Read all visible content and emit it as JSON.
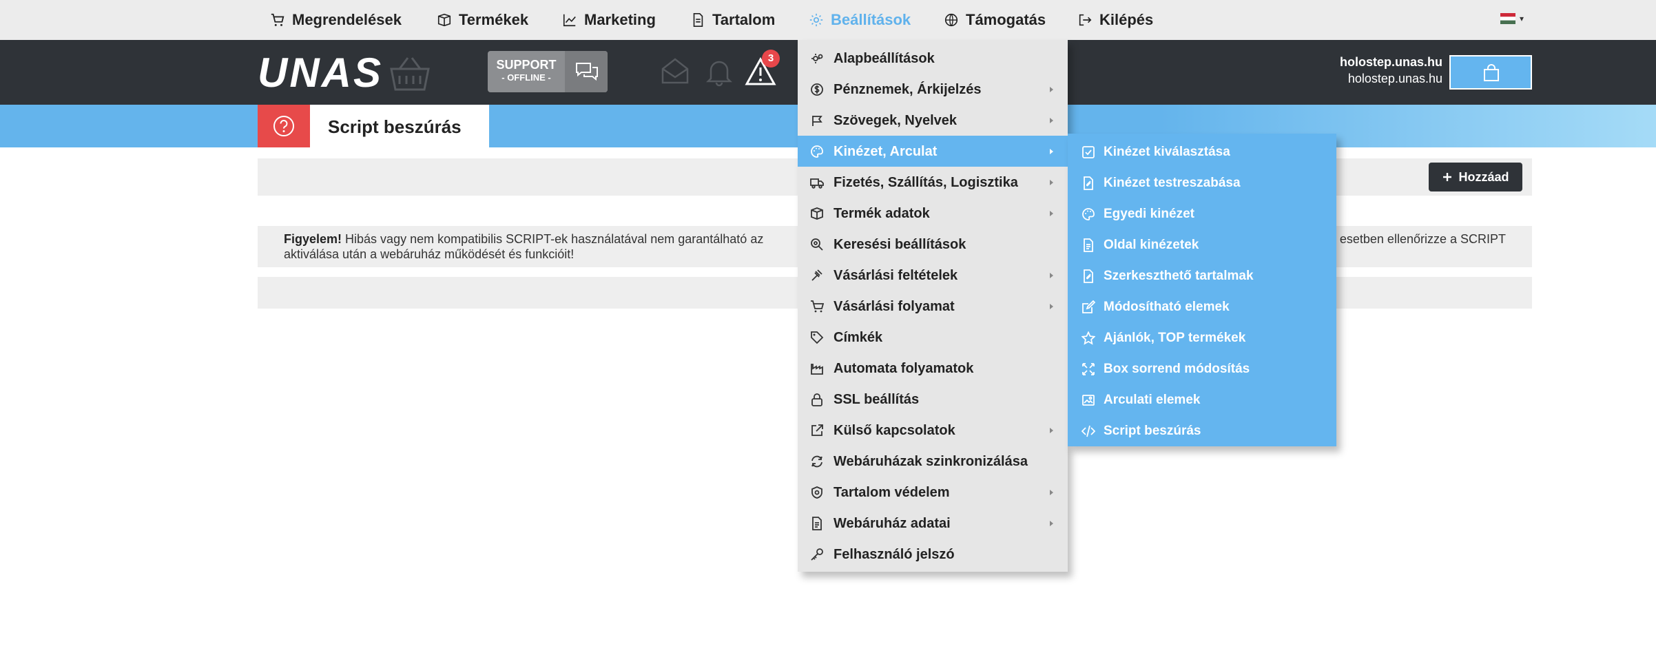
{
  "topnav": {
    "items": [
      {
        "label": "Megrendelések",
        "icon": "cart-icon"
      },
      {
        "label": "Termékek",
        "icon": "box-icon"
      },
      {
        "label": "Marketing",
        "icon": "chart-icon"
      },
      {
        "label": "Tartalom",
        "icon": "document-icon"
      },
      {
        "label": "Beállítások",
        "icon": "gear-icon",
        "active": true
      },
      {
        "label": "Támogatás",
        "icon": "globe-icon"
      },
      {
        "label": "Kilépés",
        "icon": "logout-icon"
      }
    ],
    "language_flag": "hungarian-flag-icon",
    "active_color": "#60b2ec"
  },
  "header": {
    "logo_text": "UNAS",
    "support_title": "SUPPORT",
    "support_status": "- OFFLINE -",
    "alert_count": "3",
    "domain_primary": "holostep.unas.hu",
    "domain_secondary": "holostep.unas.hu",
    "accent_color": "#64b5ef",
    "bar_color": "#2f3338"
  },
  "page": {
    "title": "Script beszúrás",
    "add_button_label": "Hozzáad",
    "notice_strong": "Figyelem!",
    "notice_text_1": " Hibás vagy nem kompatibilis SCRIPT-ek használatával nem garantálható az ",
    "notice_text_2": "esetben ellenőrizze a SCRIPT",
    "notice_text_3": "aktiválása után a webáruház működését és funkcióit!"
  },
  "settings_menu": {
    "items": [
      {
        "label": "Alapbeállítások",
        "icon": "settings-icon",
        "submenu": false
      },
      {
        "label": "Pénznemek, Árkijelzés",
        "icon": "currency-icon",
        "submenu": true
      },
      {
        "label": "Szövegek, Nyelvek",
        "icon": "flag-icon",
        "submenu": true
      },
      {
        "label": "Kinézet, Arculat",
        "icon": "palette-icon",
        "submenu": true,
        "active": true
      },
      {
        "label": "Fizetés, Szállítás, Logisztika",
        "icon": "truck-icon",
        "submenu": true
      },
      {
        "label": "Termék adatok",
        "icon": "box-icon",
        "submenu": true
      },
      {
        "label": "Keresési beállítások",
        "icon": "search-icon",
        "submenu": false
      },
      {
        "label": "Vásárlási feltételek",
        "icon": "gavel-icon",
        "submenu": true
      },
      {
        "label": "Vásárlási folyamat",
        "icon": "cart-icon",
        "submenu": true
      },
      {
        "label": "Címkék",
        "icon": "tag-icon",
        "submenu": false
      },
      {
        "label": "Automata folyamatok",
        "icon": "factory-icon",
        "submenu": false
      },
      {
        "label": "SSL beállítás",
        "icon": "lock-icon",
        "submenu": false
      },
      {
        "label": "Külső kapcsolatok",
        "icon": "external-link-icon",
        "submenu": true
      },
      {
        "label": "Webáruházak szinkronizálása",
        "icon": "sync-icon",
        "submenu": false
      },
      {
        "label": "Tartalom védelem",
        "icon": "shield-icon",
        "submenu": true
      },
      {
        "label": "Webáruház adatai",
        "icon": "document-icon",
        "submenu": true
      },
      {
        "label": "Felhasználó jelszó",
        "icon": "key-icon",
        "submenu": false
      }
    ]
  },
  "sub_menu": {
    "items": [
      {
        "label": "Kinézet kiválasztása",
        "icon": "checkbox-icon"
      },
      {
        "label": "Kinézet testreszabása",
        "icon": "edit-document-icon"
      },
      {
        "label": "Egyedi kinézet",
        "icon": "palette-icon"
      },
      {
        "label": "Oldal kinézetek",
        "icon": "document-icon"
      },
      {
        "label": "Szerkeszthető tartalmak",
        "icon": "edit-document-icon"
      },
      {
        "label": "Módosítható elemek",
        "icon": "edit-icon"
      },
      {
        "label": "Ajánlók, TOP termékek",
        "icon": "star-icon"
      },
      {
        "label": "Box sorrend módosítás",
        "icon": "move-icon"
      },
      {
        "label": "Arculati elemek",
        "icon": "image-icon"
      },
      {
        "label": "Script beszúrás",
        "icon": "code-icon"
      }
    ]
  }
}
